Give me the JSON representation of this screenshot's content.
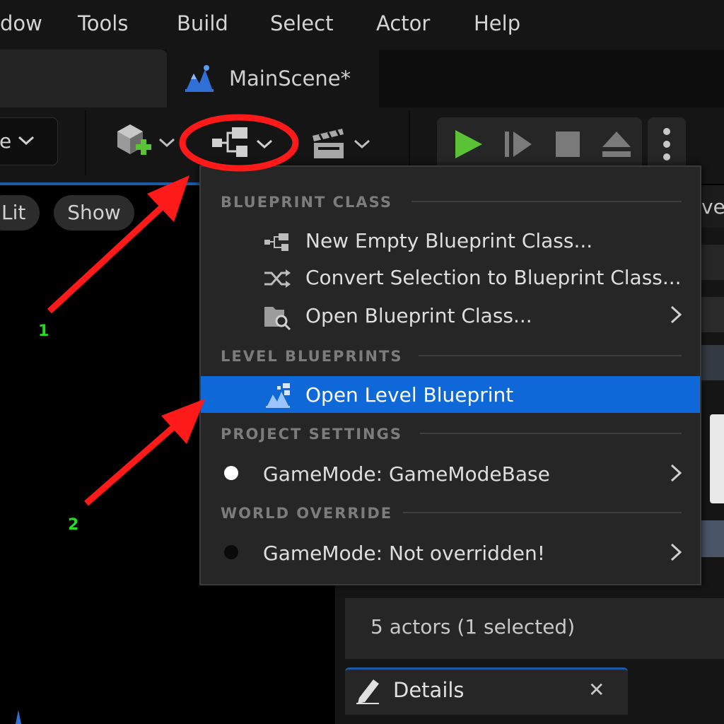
{
  "menubar": {
    "items": [
      "dow",
      "Tools",
      "Build",
      "Select",
      "Actor",
      "Help"
    ]
  },
  "tabs": {
    "active_label": "MainScene*"
  },
  "toolbar": {
    "mode_select_text": "e"
  },
  "viewport": {
    "lit_label": "Lit",
    "show_label": "Show"
  },
  "outliner": {
    "right_edge_text": "ve",
    "actor_count": "5 actors (1 selected)"
  },
  "details": {
    "tab_label": "Details",
    "close_glyph": "✕"
  },
  "dropdown": {
    "sections": [
      {
        "header": "BLUEPRINT CLASS",
        "items": [
          {
            "label": "New Empty Blueprint Class...",
            "icon": "blueprint-icon"
          },
          {
            "label": "Convert Selection to Blueprint Class...",
            "icon": "shuffle-icon"
          },
          {
            "label": "Open Blueprint Class...",
            "icon": "folder-search-icon",
            "submenu": true
          }
        ]
      },
      {
        "header": "LEVEL BLUEPRINTS",
        "items": [
          {
            "label": "Open Level Blueprint",
            "icon": "level-blueprint-icon",
            "highlighted": true
          }
        ]
      },
      {
        "header": "PROJECT SETTINGS",
        "items": [
          {
            "label": "GameMode: GameModeBase",
            "icon": "white-dot-icon",
            "submenu": true
          }
        ]
      },
      {
        "header": "WORLD OVERRIDE",
        "items": [
          {
            "label": "GameMode: Not overridden!",
            "icon": "black-dot-icon",
            "submenu": true
          }
        ]
      }
    ]
  },
  "annotations": {
    "step1": "1",
    "step2": "2",
    "color_arrow": "#ff1a1a",
    "color_number": "#22dd22"
  },
  "colors": {
    "highlight": "#0e68d8",
    "play_green": "#5bc236",
    "accent_blue": "#1e5aa8"
  }
}
